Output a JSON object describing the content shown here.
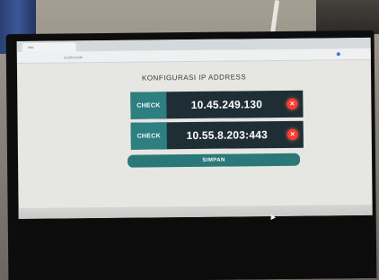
{
  "browser": {
    "tab_title": "uuu",
    "url": "localhost/dk"
  },
  "page": {
    "title": "KONFIGURASI IP ADDRESS"
  },
  "entries": [
    {
      "check_label": "CHECK",
      "ip": "10.45.249.130",
      "status_icon": "error-icon"
    },
    {
      "check_label": "CHECK",
      "ip": "10.55.8.203:443",
      "status_icon": "error-icon"
    }
  ],
  "actions": {
    "save_label": "SIMPAN"
  },
  "colors": {
    "teal": "#2d7f80",
    "dark_row": "#1f2e35",
    "error": "#ff3b2f",
    "screen_bg": "#e6e7e3"
  }
}
